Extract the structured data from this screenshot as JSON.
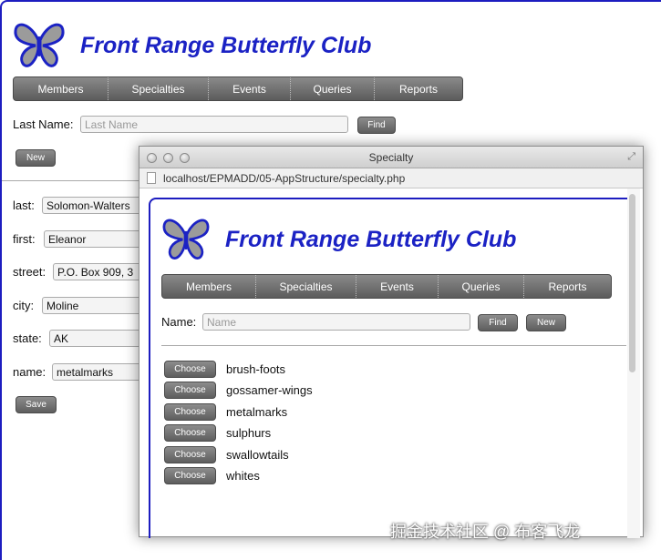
{
  "main": {
    "title": "Front Range Butterfly Club",
    "nav": [
      "Members",
      "Specialties",
      "Events",
      "Queries",
      "Reports"
    ],
    "last_name_label": "Last Name:",
    "last_name_placeholder": "Last Name",
    "find_label": "Find",
    "new_label": "New",
    "form": {
      "last_label": "last:",
      "last_value": "Solomon-Walters",
      "first_label": "first:",
      "first_value": "Eleanor",
      "street_label": "street:",
      "street_value": "P.O. Box 909, 3",
      "city_label": "city:",
      "city_value": "Moline",
      "state_label": "state:",
      "state_value": "AK",
      "name_label": "name:",
      "name_value": "metalmarks"
    },
    "save_label": "Save"
  },
  "popup": {
    "window_title": "Specialty",
    "url": "localhost/EPMADD/05-AppStructure/specialty.php",
    "title": "Front Range Butterfly Club",
    "nav": [
      "Members",
      "Specialties",
      "Events",
      "Queries",
      "Reports"
    ],
    "name_label": "Name:",
    "name_placeholder": "Name",
    "find_label": "Find",
    "new_label": "New",
    "choose_label": "Choose",
    "items": [
      "brush-foots",
      "gossamer-wings",
      "metalmarks",
      "sulphurs",
      "swallowtails",
      "whites"
    ]
  },
  "watermark": "掘金技术社区 @ 布客飞龙",
  "colors": {
    "brand_blue": "#1b22c4",
    "button_gray": "#6f6f6f",
    "butterfly_fill": "#9b9b9b"
  },
  "icons": [
    "butterfly-logo-icon",
    "page-icon",
    "resize-icon",
    "close-traffic-icon",
    "minimize-traffic-icon",
    "zoom-traffic-icon"
  ]
}
